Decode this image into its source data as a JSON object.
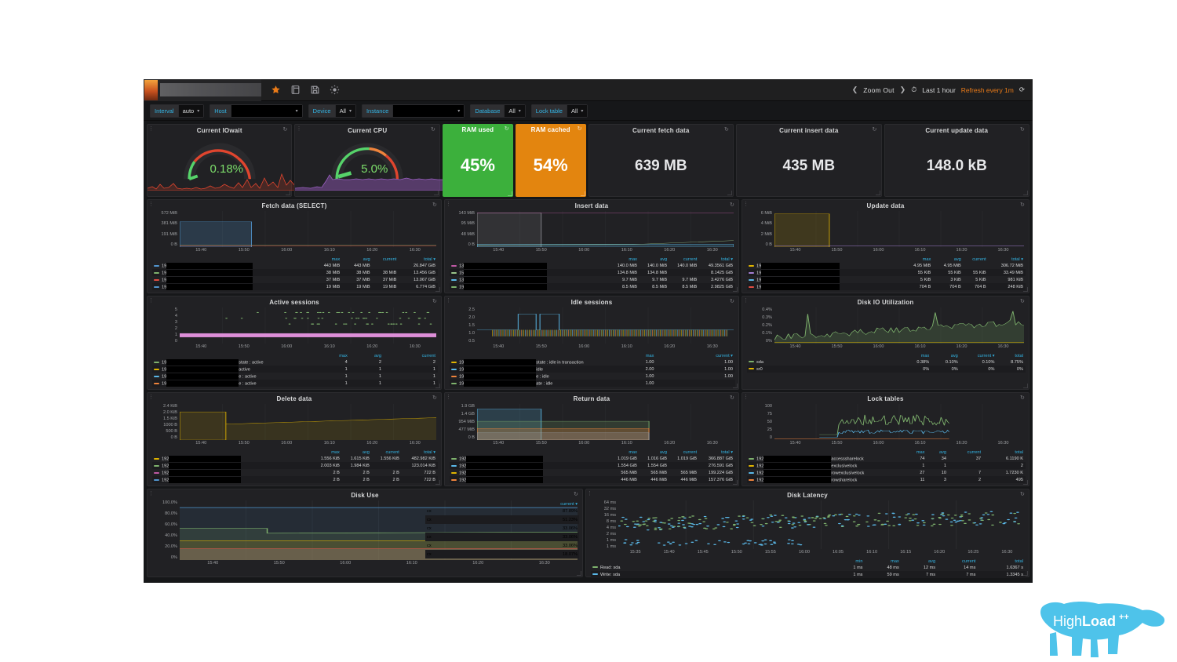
{
  "topnav": {
    "title_redacted": "",
    "icons": [
      "star-icon",
      "share-icon",
      "save-icon",
      "settings-icon"
    ],
    "zoom_out": "Zoom Out",
    "time_range": "Last 1 hour",
    "refresh": "Refresh every 1m",
    "reload_icon": "⟳"
  },
  "variables": [
    {
      "label": "Interval",
      "value": "auto",
      "redacted": false
    },
    {
      "label": "Host",
      "value": "",
      "redacted": true
    },
    {
      "label": "Device",
      "value": "All",
      "redacted": false
    },
    {
      "label": "Instance",
      "value": "",
      "redacted": true
    },
    {
      "label": "Database",
      "value": "All",
      "redacted": false
    },
    {
      "label": "Lock table",
      "value": "All",
      "redacted": false
    }
  ],
  "stats": {
    "iowait": {
      "title": "Current IOwait",
      "value": "0.18%"
    },
    "cpu": {
      "title": "Current CPU",
      "value": "5.0%"
    },
    "ram_used": {
      "title": "RAM used",
      "value": "45%",
      "color": "#3cb03c"
    },
    "ram_cached": {
      "title": "RAM cached",
      "value": "54%",
      "color": "#e3850f"
    },
    "fetch": {
      "title": "Current fetch data",
      "value": "639 MB"
    },
    "insert": {
      "title": "Current insert data",
      "value": "435 MB"
    },
    "update": {
      "title": "Current update data",
      "value": "148.0 kB"
    }
  },
  "chart_data": [
    {
      "id": "fetch_select",
      "type": "area",
      "title": "Fetch data (SELECT)",
      "yticks": [
        "572 MiB",
        "381 MiB",
        "191 MiB",
        "0 B"
      ],
      "xticks": [
        "15:40",
        "15:50",
        "16:00",
        "16:10",
        "16:20",
        "16:30"
      ],
      "columns": [
        "max",
        "avg",
        "current",
        "total"
      ],
      "sort": "total",
      "rows": [
        {
          "color": "#5195ce",
          "name": "19",
          "redacted_w": 110,
          "values": [
            "443 MiB",
            "443 MiB",
            "",
            "26.847 GiB"
          ]
        },
        {
          "color": "#7eb26d",
          "name": "19",
          "redacted_w": 110,
          "values": [
            "38 MiB",
            "38 MiB",
            "38 MiB",
            "13.456 GiB"
          ]
        },
        {
          "color": "#e24d42",
          "name": "19",
          "redacted_w": 110,
          "values": [
            "37 MiB",
            "37 MiB",
            "37 MiB",
            "13.067 GiB"
          ]
        },
        {
          "color": "#5195ce",
          "name": "19",
          "redacted_w": 110,
          "values": [
            "19 MiB",
            "19 MiB",
            "19 MiB",
            "6.774 GiB"
          ]
        }
      ]
    },
    {
      "id": "insert_data",
      "type": "area",
      "title": "Insert data",
      "yticks": [
        "143 MiB",
        "95 MiB",
        "48 MiB",
        "0 B"
      ],
      "xticks": [
        "15:40",
        "15:50",
        "16:00",
        "16:10",
        "16:20",
        "16:30"
      ],
      "columns": [
        "max",
        "avg",
        "current",
        "total"
      ],
      "sort": "total",
      "rows": [
        {
          "color": "#bf59a5",
          "name": "13",
          "redacted_w": 106,
          "values": [
            "140.0 MiB",
            "140.0 MiB",
            "140.0 MiB",
            "49.3561 GiB"
          ]
        },
        {
          "color": "#9ac48a",
          "name": "15",
          "redacted_w": 106,
          "values": [
            "134.8 MiB",
            "134.8 MiB",
            "",
            "8.1425 GiB"
          ]
        },
        {
          "color": "#5ab8e8",
          "name": "13",
          "redacted_w": 106,
          "values": [
            "9.7 MiB",
            "9.7 MiB",
            "9.7 MiB",
            "3.4276 GiB"
          ]
        },
        {
          "color": "#7eb26d",
          "name": "19",
          "redacted_w": 106,
          "values": [
            "8.5 MiB",
            "8.5 MiB",
            "8.5 MiB",
            "2.9825 GiB"
          ]
        }
      ]
    },
    {
      "id": "update_data",
      "type": "area",
      "title": "Update data",
      "yticks": [
        "6 MiB",
        "4 MiB",
        "2 MiB",
        "0 B"
      ],
      "xticks": [
        "15:40",
        "15:50",
        "16:00",
        "16:10",
        "16:20",
        "16:30"
      ],
      "columns": [
        "max",
        "avg",
        "current",
        "total"
      ],
      "sort": "total",
      "rows": [
        {
          "color": "#e0b400",
          "name": "19",
          "redacted_w": 100,
          "values": [
            "4.95 MiB",
            "4.95 MiB",
            "",
            "306.72 MiB"
          ]
        },
        {
          "color": "#a57fd4",
          "name": "19",
          "redacted_w": 100,
          "values": [
            "55 KiB",
            "55 KiB",
            "55 KiB",
            "33.49 MiB"
          ]
        },
        {
          "color": "#5ab8e8",
          "name": "19",
          "redacted_w": 100,
          "values": [
            "5 KiB",
            "3 KiB",
            "5 KiB",
            "981 KiB"
          ]
        },
        {
          "color": "#e24d42",
          "name": "19",
          "redacted_w": 100,
          "values": [
            "704 B",
            "704 B",
            "704 B",
            "248 KiB"
          ]
        }
      ]
    },
    {
      "id": "active_sessions",
      "type": "scatter",
      "title": "Active sessions",
      "yticks": [
        "5",
        "4",
        "3",
        "2",
        "1",
        "0"
      ],
      "xticks": [
        "15:40",
        "15:50",
        "16:00",
        "16:10",
        "16:20",
        "16:30"
      ],
      "columns": [
        "max",
        "avg",
        "current"
      ],
      "sort": "",
      "rows": [
        {
          "color": "#7eb26d",
          "name": "19",
          "redacted_w": 92,
          "suffix": "state : active",
          "values": [
            "4",
            "2",
            "2"
          ]
        },
        {
          "color": "#e0b400",
          "name": "19",
          "redacted_w": 92,
          "suffix": "active",
          "values": [
            "1",
            "1",
            "1"
          ]
        },
        {
          "color": "#5ab8e8",
          "name": "19",
          "redacted_w": 92,
          "suffix": "e : active",
          "values": [
            "1",
            "1",
            "1"
          ]
        },
        {
          "color": "#ef843c",
          "name": "19",
          "redacted_w": 92,
          "suffix": "e : active",
          "values": [
            "1",
            "1",
            "1"
          ]
        }
      ]
    },
    {
      "id": "idle_sessions",
      "type": "line",
      "title": "Idle sessions",
      "yticks": [
        "2.5",
        "2.0",
        "1.5",
        "1.0",
        "0.5"
      ],
      "xticks": [
        "15:40",
        "15:50",
        "16:00",
        "16:10",
        "16:20",
        "16:30"
      ],
      "columns": [
        "max",
        "current"
      ],
      "sort": "current",
      "rows": [
        {
          "color": "#e0b400",
          "name": "19",
          "redacted_w": 92,
          "suffix": "state : idle in transaction",
          "values": [
            "1.00",
            "1.00"
          ]
        },
        {
          "color": "#5ab8e8",
          "name": "19",
          "redacted_w": 92,
          "suffix": "idle",
          "values": [
            "2.00",
            "1.00"
          ]
        },
        {
          "color": "#ef843c",
          "name": "19",
          "redacted_w": 92,
          "suffix": "e : idle",
          "values": [
            "1.00",
            "1.00"
          ]
        },
        {
          "color": "#7eb26d",
          "name": "19",
          "redacted_w": 92,
          "suffix": "ate : idle",
          "values": [
            "1.00",
            ""
          ]
        }
      ]
    },
    {
      "id": "disk_io_util",
      "type": "area",
      "title": "Disk IO Utilization",
      "yticks": [
        "0.4%",
        "0.3%",
        "0.2%",
        "0.1%",
        "0%"
      ],
      "xticks": [
        "15:40",
        "15:50",
        "16:00",
        "16:10",
        "16:20",
        "16:30"
      ],
      "columns": [
        "max",
        "avg",
        "current",
        "total"
      ],
      "sort": "current",
      "rows": [
        {
          "color": "#7eb26d",
          "name": "sda",
          "redacted_w": 0,
          "values": [
            "0.38%",
            "0.10%",
            "0.10%",
            "8.75%"
          ]
        },
        {
          "color": "#e0b400",
          "name": "sr0",
          "redacted_w": 0,
          "values": [
            "0%",
            "0%",
            "0%",
            "0%"
          ]
        }
      ]
    },
    {
      "id": "delete_data",
      "type": "area",
      "title": "Delete data",
      "yticks": [
        "2.4 KiB",
        "2.0 KiB",
        "1.5 KiB",
        "1000 B",
        "500 B",
        "0 B"
      ],
      "xticks": [
        "15:40",
        "15:50",
        "16:00",
        "16:10",
        "16:20",
        "16:30"
      ],
      "columns": [
        "max",
        "avg",
        "current",
        "total"
      ],
      "sort": "total",
      "rows": [
        {
          "color": "#e0b400",
          "name": "192",
          "redacted_w": 92,
          "values": [
            "1.556 KiB",
            "1.615 KiB",
            "1.556 KiB",
            "482.982 KiB"
          ]
        },
        {
          "color": "#7eb26d",
          "name": "192",
          "redacted_w": 92,
          "values": [
            "2.003 KiB",
            "1.984 KiB",
            "",
            "123.014 KiB"
          ]
        },
        {
          "color": "#bf59a5",
          "name": "192",
          "redacted_w": 92,
          "values": [
            "2 B",
            "2 B",
            "2 B",
            "722 B"
          ]
        },
        {
          "color": "#5195ce",
          "name": "192",
          "redacted_w": 92,
          "values": [
            "2 B",
            "2 B",
            "2 B",
            "722 B"
          ]
        }
      ]
    },
    {
      "id": "return_data",
      "type": "area",
      "title": "Return data",
      "yticks": [
        "1.9 GB",
        "1.4 GB",
        "954 MiB",
        "477 MiB",
        "0 B"
      ],
      "xticks": [
        "15:40",
        "15:50",
        "16:00",
        "16:10",
        "16:20",
        "16:30"
      ],
      "columns": [
        "max",
        "avg",
        "current",
        "total"
      ],
      "sort": "total",
      "rows": [
        {
          "color": "#7eb26d",
          "name": "192",
          "redacted_w": 98,
          "values": [
            "1.019 GiB",
            "1.016 GiB",
            "1.019 GiB",
            "366.887 GiB"
          ]
        },
        {
          "color": "#5ab8e8",
          "name": "192",
          "redacted_w": 98,
          "values": [
            "1.554 GiB",
            "1.554 GiB",
            "",
            "276.591 GiB"
          ]
        },
        {
          "color": "#e0b400",
          "name": "192",
          "redacted_w": 98,
          "values": [
            "565 MiB",
            "565 MiB",
            "565 MiB",
            "199.224 GiB"
          ]
        },
        {
          "color": "#ef843c",
          "name": "192",
          "redacted_w": 98,
          "values": [
            "446 MiB",
            "446 MiB",
            "446 MiB",
            "157.376 GiB"
          ]
        }
      ]
    },
    {
      "id": "lock_tables",
      "type": "line",
      "title": "Lock tables",
      "yticks": [
        "100",
        "75",
        "50",
        "25",
        "0"
      ],
      "xticks": [
        "15:40",
        "15:50",
        "16:00",
        "16:10",
        "16:20",
        "16:30"
      ],
      "columns": [
        "max",
        "avg",
        "current",
        "total"
      ],
      "sort": "",
      "rows": [
        {
          "color": "#7eb26d",
          "name": "192",
          "redacted_w": 86,
          "suffix": "accesssharelock",
          "values": [
            "74",
            "34",
            "37",
            "6.1190 K"
          ]
        },
        {
          "color": "#e0b400",
          "name": "192",
          "redacted_w": 86,
          "suffix": "exclusivelock",
          "values": [
            "1",
            "1",
            "",
            "2"
          ]
        },
        {
          "color": "#5ab8e8",
          "name": "192",
          "redacted_w": 86,
          "suffix": "rowexclusivelock",
          "values": [
            "27",
            "10",
            "7",
            "1.7230 K"
          ]
        },
        {
          "color": "#ef843c",
          "name": "192",
          "redacted_w": 86,
          "suffix": "rowsharelock",
          "values": [
            "11",
            "3",
            "2",
            "495"
          ]
        }
      ]
    },
    {
      "id": "disk_use",
      "type": "line",
      "title": "Disk Use",
      "yticks": [
        "100.0%",
        "80.0%",
        "60.0%",
        "40.0%",
        "20.0%",
        "0%"
      ],
      "xticks": [
        "15:40",
        "15:50",
        "16:00",
        "16:10",
        "16:20",
        "16:30"
      ],
      "columns": [
        "current"
      ],
      "sort": "current",
      "rows": [
        {
          "color": "#5195ce",
          "name": "c",
          "redacted_w": 100,
          "values": [
            "87.89%"
          ]
        },
        {
          "color": "#7eb26d",
          "name": "c",
          "redacted_w": 100,
          "values": [
            "51.23%"
          ]
        },
        {
          "color": "#ef843c",
          "name": "c",
          "redacted_w": 100,
          "values": [
            "33.06%"
          ]
        },
        {
          "color": "#5ab8e8",
          "name": "c",
          "redacted_w": 100,
          "values": [
            "33.06%"
          ]
        },
        {
          "color": "#e0b400",
          "name": "c",
          "redacted_w": 100,
          "values": [
            "33.06%"
          ]
        },
        {
          "color": "#e24d42",
          "name": "c",
          "redacted_w": 100,
          "values": [
            "18.07%"
          ]
        }
      ]
    },
    {
      "id": "disk_latency",
      "type": "scatter",
      "title": "Disk Latency",
      "yticks": [
        "64 ms",
        "32 ms",
        "16 ms",
        "8 ms",
        "4 ms",
        "2 ms",
        "1 ms",
        "1 ms"
      ],
      "xticks": [
        "15:35",
        "15:40",
        "15:45",
        "15:50",
        "15:55",
        "16:00",
        "16:05",
        "16:10",
        "16:15",
        "16:20",
        "16:25",
        "16:30"
      ],
      "columns": [
        "min",
        "max",
        "avg",
        "current",
        "total"
      ],
      "sort": "",
      "rows": [
        {
          "color": "#7eb26d",
          "name": "Read: sda",
          "redacted_w": 0,
          "values": [
            "1 ms",
            "48 ms",
            "12 ms",
            "14 ms",
            "1.6367 s"
          ]
        },
        {
          "color": "#5ab8e8",
          "name": "Write: sda",
          "redacted_w": 0,
          "values": [
            "1 ms",
            "59 ms",
            "7 ms",
            "7 ms",
            "1.3345 s"
          ]
        }
      ]
    }
  ],
  "logo": {
    "text_light": "High",
    "text_bold": "Load",
    "sup": "++",
    "color": "#4ec3ea"
  }
}
